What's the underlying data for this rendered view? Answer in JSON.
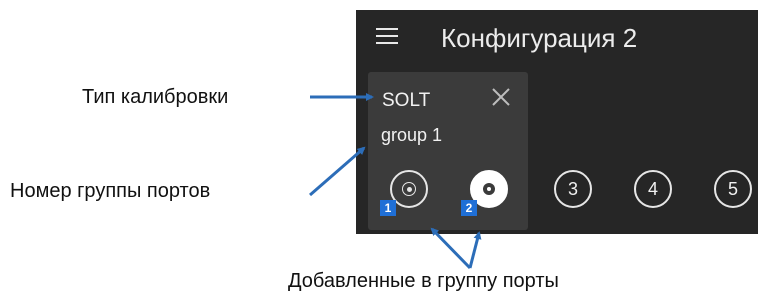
{
  "header": {
    "title": "Конфигурация 2",
    "menu_icon": "hamburger-menu-icon"
  },
  "card": {
    "calibration_type": "SOLT",
    "close_icon": "close-icon",
    "group_label": "group 1",
    "added_ports": [
      {
        "badge": "1",
        "state": "added"
      },
      {
        "badge": "2",
        "state": "added-active"
      }
    ],
    "other_ports": [
      {
        "label": "3"
      },
      {
        "label": "4"
      },
      {
        "label": "5"
      }
    ]
  },
  "annotations": {
    "calibration_type_label": "Тип калибровки",
    "port_group_label": "Номер группы портов",
    "added_ports_label": "Добавленные в группу порты"
  },
  "colors": {
    "panel_bg": "#262626",
    "card_bg": "#3b3b3b",
    "badge_blue": "#1f6fd6",
    "arrow_blue": "#2c6db8"
  }
}
